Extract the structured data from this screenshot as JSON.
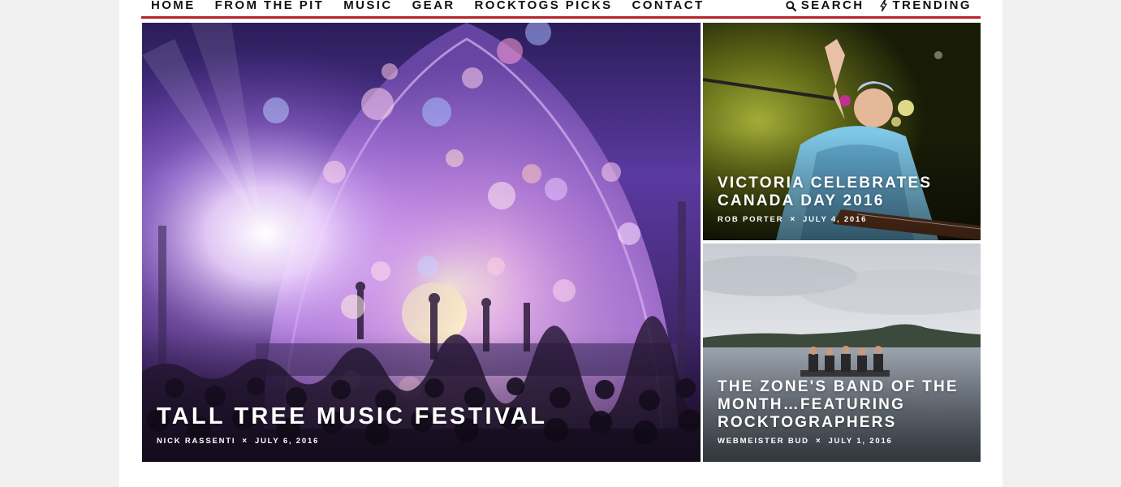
{
  "nav": {
    "items": [
      {
        "label": "HOME"
      },
      {
        "label": "FROM THE PIT"
      },
      {
        "label": "MUSIC"
      },
      {
        "label": "GEAR"
      },
      {
        "label": "ROCKTOGS PICKS"
      },
      {
        "label": "CONTACT"
      }
    ],
    "search_label": "SEARCH",
    "trending_label": "TRENDING",
    "search_icon": "search-icon",
    "trending_icon": "bolt-icon",
    "accent_color": "#b3252a"
  },
  "featured": {
    "main": {
      "title": "TALL TREE MUSIC FESTIVAL",
      "author": "NICK RASSENTI",
      "separator": "×",
      "date": "JULY 6, 2016"
    },
    "top": {
      "title": "VICTORIA CELEBRATES CANADA DAY 2016",
      "author": "ROB PORTER",
      "separator": "×",
      "date": "JULY 4, 2016"
    },
    "bottom": {
      "title": "THE ZONE'S BAND OF THE MONTH…FEATURING ROCKTOGRAPHERS",
      "author": "WEBMEISTER BUD",
      "separator": "×",
      "date": "JULY 1, 2016"
    }
  }
}
